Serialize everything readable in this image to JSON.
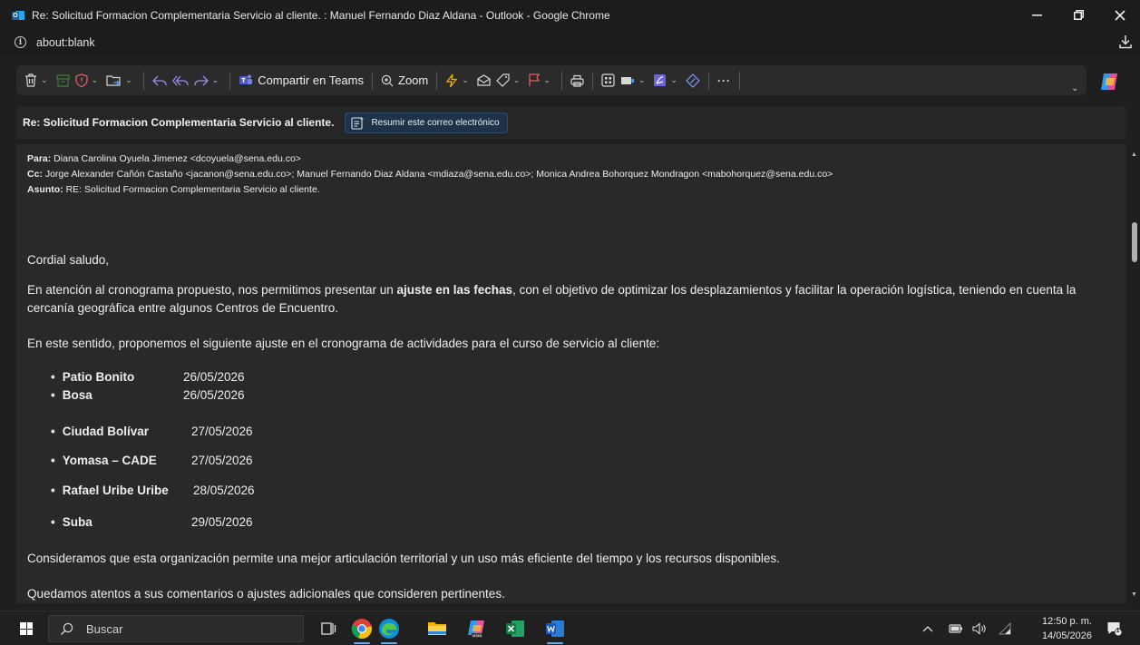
{
  "window": {
    "title": "Re: Solicitud Formacion Complementaria Servicio al cliente. : Manuel Fernando Diaz Aldana - Outlook - Google Chrome",
    "address": "about:blank"
  },
  "toolbar": {
    "teams_label": "Compartir en Teams",
    "zoom_label": "Zoom",
    "more_label": "···"
  },
  "email": {
    "subject": "Re: Solicitud Formacion Complementaria Servicio al cliente.",
    "summarize_label": "Resumir este correo electrónico",
    "to_label": "Para:",
    "to_value": " Diana Carolina Oyuela Jimenez <dcoyuela@sena.edu.co>",
    "cc_label": "Cc:",
    "cc_value": " Jorge Alexander Cañón Castaño <jacanon@sena.edu.co>; Manuel Fernando Diaz Aldana <mdiaza@sena.edu.co>; Monica Andrea Bohorquez Mondragon <mabohorquez@sena.edu.co>",
    "subject_label": "Asunto:",
    "subject_value": " RE: Solicitud Formacion Complementaria Servicio al cliente.",
    "greeting": "Cordial saludo,",
    "p1_before": "En atención al cronograma propuesto, nos permitimos presentar un ",
    "p1_bold": "ajuste en las fechas",
    "p1_after": ", con el objetivo de optimizar los desplazamientos y facilitar la operación logística, teniendo en cuenta la cercanía geográfica entre algunos Centros de Encuentro.",
    "p2": "En este sentido, proponemos el siguiente ajuste en el cronograma de actividades para el curso de servicio al cliente:",
    "schedule": [
      {
        "place": "Patio Bonito",
        "date": "26/05/2026"
      },
      {
        "place": "Bosa",
        "date": "26/05/2026"
      },
      {
        "place": "Ciudad Bolívar",
        "date": "27/05/2026"
      },
      {
        "place": "Yomasa – CADE",
        "date": "27/05/2026"
      },
      {
        "place": "Rafael Uribe Uribe",
        "date": "28/05/2026"
      },
      {
        "place": "Suba",
        "date": "29/05/2026"
      }
    ],
    "p3": "Consideramos que esta organización permite una mejor articulación territorial y un uso más eficiente del tiempo y los recursos disponibles.",
    "p4": "Quedamos atentos a sus comentarios o ajustes adicionales que consideren pertinentes."
  },
  "taskbar": {
    "search_placeholder": "Buscar",
    "time": "12:50 p. m.",
    "date": "14/05/2026",
    "notification_count": "1"
  }
}
